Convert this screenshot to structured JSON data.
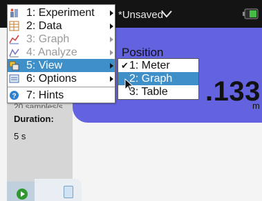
{
  "header": {
    "doc_title": "*Unsaved"
  },
  "menu": {
    "items": [
      {
        "label": "1: Experiment",
        "icon": "experiment-icon",
        "disabled": false,
        "submenu": true
      },
      {
        "label": "2: Data",
        "icon": "data-table-icon",
        "disabled": false,
        "submenu": true
      },
      {
        "label": "3: Graph",
        "icon": "graph-icon",
        "disabled": true,
        "submenu": true
      },
      {
        "label": "4: Analyze",
        "icon": "analyze-icon",
        "disabled": true,
        "submenu": true
      },
      {
        "label": "5: View",
        "icon": "view-icon",
        "disabled": false,
        "submenu": true,
        "selected": true
      },
      {
        "label": "6: Options",
        "icon": "options-icon",
        "disabled": false,
        "submenu": true
      },
      {
        "label": "7: Hints",
        "icon": "help-icon",
        "disabled": false,
        "submenu": false
      }
    ]
  },
  "view_submenu": {
    "items": [
      {
        "label": "1: Meter",
        "checked": true
      },
      {
        "label": "2: Graph",
        "selected": true
      },
      {
        "label": "3: Table"
      }
    ]
  },
  "meter": {
    "label": "Position",
    "reading": ".133",
    "unit": "m"
  },
  "info_panel": {
    "samples_text": "20 samples/s",
    "duration_label": "Duration:",
    "duration_value": "5 s"
  },
  "colors": {
    "meter_background": "#6363e0",
    "menu_highlight": "#3f8fc8",
    "topbar": "#141414"
  }
}
